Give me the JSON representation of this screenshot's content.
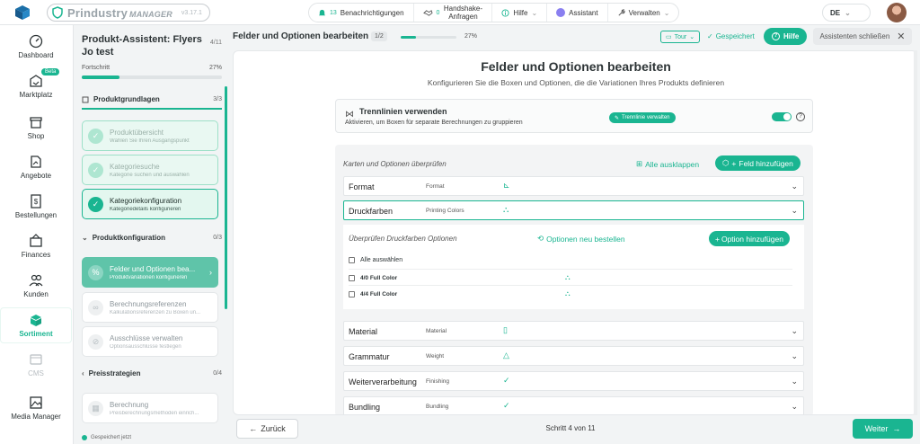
{
  "colors": {
    "accent": "#1ab591",
    "accent_light": "#e3f7ef",
    "sidebar_selected": "#5fc4a9"
  },
  "app": {
    "logo_name": "Prindustry",
    "logo_suffix": "MANAGER",
    "version": "v3.17.1"
  },
  "topnav": {
    "notifications": {
      "count": "13",
      "label": "Benachrichtigungen",
      "icon": "bell-icon"
    },
    "handshake": {
      "count": "0",
      "label": "Handshake-Anfragen",
      "icon": "handshake-icon"
    },
    "help": {
      "label": "Hilfe",
      "icon": "info-icon"
    },
    "assistant": {
      "label": "Assistant",
      "icon": "sparkle-icon"
    },
    "manage": {
      "label": "Verwalten",
      "icon": "wrench-icon"
    },
    "language": "DE"
  },
  "leftnav": {
    "items": [
      {
        "label": "Dashboard",
        "icon": "gauge-icon"
      },
      {
        "label": "Marktplatz",
        "icon": "store-icon",
        "badge": "Beta"
      },
      {
        "label": "Shop",
        "icon": "shop-icon"
      },
      {
        "label": "Angebote",
        "icon": "quote-icon"
      },
      {
        "label": "Bestellungen",
        "icon": "receipt-icon"
      },
      {
        "label": "Finances",
        "icon": "finance-icon"
      },
      {
        "label": "Kunden",
        "icon": "users-icon"
      },
      {
        "label": "Sortiment",
        "icon": "box-icon"
      },
      {
        "label": "CMS",
        "icon": "cms-icon"
      },
      {
        "label": "Media Manager",
        "icon": "image-icon"
      }
    ]
  },
  "assistant": {
    "title": "Produkt-Assistent: Flyers Jo test",
    "step": "4/11",
    "progress_label": "Fortschritt",
    "progress_pct": "27%",
    "progress_value": 0.27,
    "sections": [
      {
        "label": "Produktgrundlagen",
        "count": "3/3"
      },
      {
        "label": "Produktkonfiguration",
        "count": "0/3"
      },
      {
        "label": "Preisstrategien",
        "count": "0/4"
      }
    ],
    "steps": [
      {
        "title": "Produktübersicht",
        "desc": "Wählen Sie Ihren Ausgangspunkt"
      },
      {
        "title": "Kategoriesuche",
        "desc": "Kategorie suchen und auswählen"
      },
      {
        "title": "Kategoriekonfiguration",
        "desc": "Kategoriedetails konfigurieren"
      },
      {
        "title": "Felder und Optionen bea...",
        "desc": "Produktvariationen konfigurieren"
      },
      {
        "title": "Berechnungsreferenzen",
        "desc": "Kalkulationsreferenzen zu Boxen un..."
      },
      {
        "title": "Ausschlüsse verwalten",
        "desc": "Optionsausschlüsse festlegen"
      },
      {
        "title": "Berechnung",
        "desc": "Preisberechnungsmethoden einrich..."
      }
    ],
    "saved": "Gespeichert jetzt"
  },
  "header": {
    "title": "Felder und Optionen bearbeiten",
    "step": "1/2",
    "pct": "27%",
    "progress_value": 0.27,
    "tour": "Tour",
    "saved": "Gespeichert",
    "help": "Hilfe",
    "close": "Assistenten schließen"
  },
  "content": {
    "title": "Felder und Optionen bearbeiten",
    "subtitle": "Konfigurieren Sie die Boxen und Optionen, die die Variationen Ihres Produkts definieren",
    "divider": {
      "title": "Trennlinien verwenden",
      "desc": "Aktivieren, um Boxen für separate Berechnungen zu gruppieren",
      "pill": "Trennlinie verwalten",
      "enabled": true
    },
    "cards_header": "Karten und Optionen überprüfen",
    "expand_all": "Alle ausklappen",
    "add_field": "Feld hinzufügen",
    "fields": [
      {
        "name": "Format",
        "sub": "Format",
        "icon": "format-icon"
      },
      {
        "name": "Druckfarben",
        "sub": "Printing Colors",
        "icon": "palette-icon"
      },
      {
        "name": "Material",
        "sub": "Material",
        "icon": "file-icon"
      },
      {
        "name": "Grammatur",
        "sub": "Weight",
        "icon": "weight-icon"
      },
      {
        "name": "Weiterverarbeitung",
        "sub": "Finishing",
        "icon": "check-icon"
      },
      {
        "name": "Bundling",
        "sub": "Bundling",
        "icon": "check-icon"
      }
    ],
    "expanded": {
      "header": "Überprüfen Druckfarben Optionen",
      "reorder": "Optionen neu bestellen",
      "add_option": "Option hinzufügen",
      "select_all": "Alle auswählen",
      "options": [
        "4/0 Full Color",
        "4/4 Full Color"
      ]
    }
  },
  "footer": {
    "back": "Zurück",
    "step": "Schritt 4 von 11",
    "next": "Weiter"
  }
}
